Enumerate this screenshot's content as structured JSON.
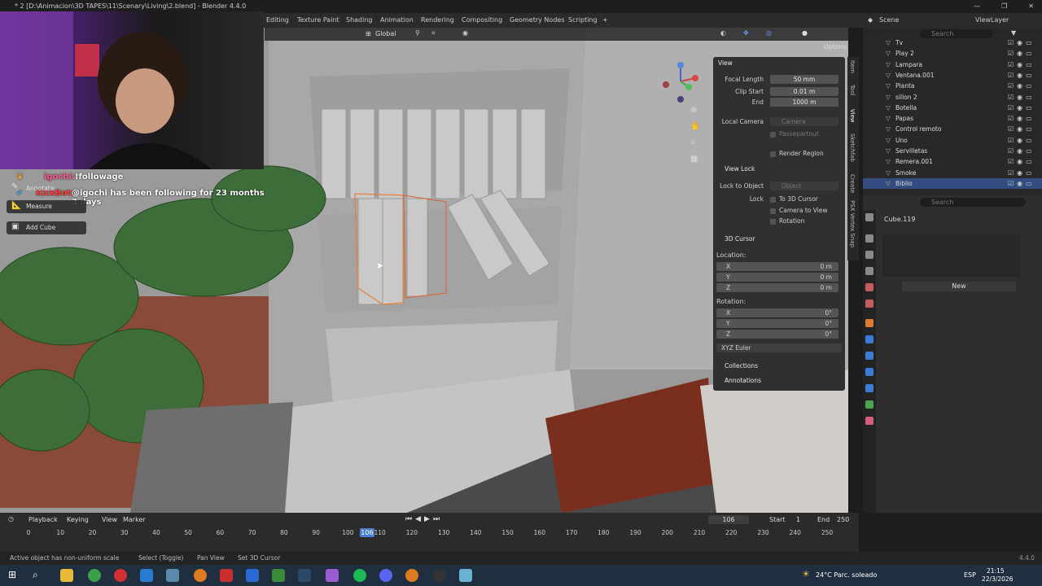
{
  "window": {
    "title": "* 2 [D:\\Animacion\\3D TAPES\\11\\Scenary\\Living\\2.blend] - Blender 4.4.0",
    "controls": [
      "—",
      "❐",
      "✕"
    ]
  },
  "workspaces": [
    "Editing",
    "Texture Paint",
    "Shading",
    "Animation",
    "Rendering",
    "Compositing",
    "Geometry Nodes",
    "Scripting",
    "+"
  ],
  "vp_header": {
    "orientation": "Global",
    "options": "Options"
  },
  "chat": {
    "line1_user": "igochi:",
    "line1_msg": "!followage",
    "line2_user": "KickBot:",
    "line2_msg": "@igochi has been following for 23 months 3 days"
  },
  "tools": {
    "annotate": "Annotate",
    "measure": "Measure",
    "add_cube": "Add Cube"
  },
  "npanel": {
    "view": "View",
    "focal_label": "Focal Length",
    "focal": "50 mm",
    "clip_start_label": "Clip Start",
    "clip_start": "0.01 m",
    "end_label": "End",
    "end": "1000 m",
    "local_camera": "Local Camera",
    "camera": "Camera",
    "passepartout": "Passepartout",
    "render_region": "Render Region",
    "view_lock": "View Lock",
    "lock_to_object": "Lock to Object",
    "object": "Object",
    "lock": "Lock",
    "to_3d_cursor": "To 3D Cursor",
    "camera_to_view": "Camera to View",
    "rotation_chk": "Rotation",
    "cursor": "3D Cursor",
    "location": "Location:",
    "x": "X",
    "y": "Y",
    "z": "Z",
    "lx": "0 m",
    "ly": "0 m",
    "lz": "0 m",
    "rotation": "Rotation:",
    "rx": "0°",
    "ry": "0°",
    "rz": "0°",
    "euler": "XYZ Euler",
    "collections": "Collections",
    "annotations": "Annotations"
  },
  "ntabs": [
    "Item",
    "Tool",
    "View",
    "Sketchfab",
    "Create",
    "PSX Vertex Snap"
  ],
  "outliner": {
    "scene": "Scene",
    "view_layer": "ViewLayer",
    "search": "Search",
    "items": [
      "Tv",
      "Play 2",
      "Lampara",
      "Ventana.001",
      "Planta",
      "sillon 2",
      "Botella",
      "Papas",
      "Control remoto",
      "Uno",
      "Servilletas",
      "Remera.001",
      "Smoke",
      "Biblio"
    ]
  },
  "props": {
    "search": "Search",
    "object": "Cube.119",
    "new": "New"
  },
  "timeline": {
    "playback": "Playback",
    "keying": "Keying",
    "view": "View",
    "marker": "Marker",
    "frame": "106",
    "start_label": "Start",
    "start": "1",
    "end_label": "End",
    "end": "250",
    "ticks": [
      "0",
      "10",
      "20",
      "30",
      "40",
      "50",
      "60",
      "70",
      "80",
      "90",
      "100",
      "110",
      "120",
      "130",
      "140",
      "150",
      "160",
      "170",
      "180",
      "190",
      "200",
      "210",
      "220",
      "230",
      "240",
      "250"
    ]
  },
  "status": {
    "warning": "Active object has non-uniform scale",
    "select": "Select (Toggle)",
    "pan": "Pan View",
    "cursor": "Set 3D Cursor",
    "version": "4.4.0"
  },
  "taskbar": {
    "weather": "24°C Parc. soleado",
    "lang": "ESP",
    "time": "21:15",
    "date": "22/3/2026"
  }
}
